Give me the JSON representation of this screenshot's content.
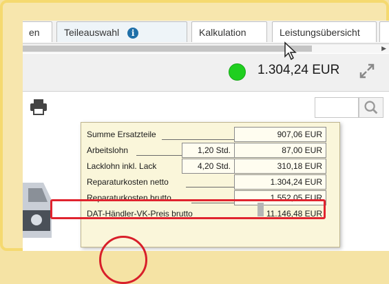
{
  "tabs": [
    {
      "label": "en"
    },
    {
      "label": "Teileauswahl",
      "info_icon": "i"
    },
    {
      "label": "Kalkulation"
    },
    {
      "label": "Leistungsübersicht"
    }
  ],
  "toolbar": {
    "total": "1.304,24 EUR",
    "status_color": "#1fcf1f"
  },
  "popup": {
    "rows": [
      {
        "label": "Summe Ersatzteile",
        "hours": "",
        "value": "907,06 EUR"
      },
      {
        "label": "Arbeitslohn",
        "hours": "1,20 Std.",
        "value": "87,00 EUR"
      },
      {
        "label": "Lacklohn inkl. Lack",
        "hours": "4,20 Std.",
        "value": "310,18 EUR"
      },
      {
        "label": "Reparaturkosten netto",
        "hours": "",
        "value": "1.304,24 EUR"
      },
      {
        "label": "Reparaturkosten brutto",
        "hours": "",
        "value": "1.552,05 EUR"
      },
      {
        "label": "DAT-Händler-VK-Preis brutto",
        "hours": "",
        "value": "11.146,48 EUR"
      }
    ]
  },
  "colors": {
    "highlight": "#e0232e",
    "frame": "#f5d96f"
  }
}
